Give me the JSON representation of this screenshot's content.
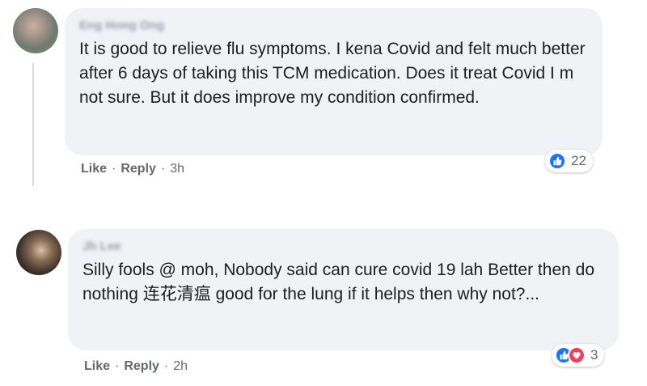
{
  "comments": [
    {
      "author": "Eng Hong Ong",
      "text": "It is good to relieve flu symptoms. I kena Covid and felt much better after 6 days of taking this TCM medication. Does it treat Covid I m not sure. But it does improve my condition confirmed.",
      "like_label": "Like",
      "reply_label": "Reply",
      "time": "3h",
      "reaction_count": "22",
      "reactions": [
        "like-icon"
      ]
    },
    {
      "author": "Jh Lee",
      "text": "Silly fools @ moh, Nobody said can cure covid 19 lah Better then do nothing 连花清瘟 good for the lung if it helps then why not?...",
      "like_label": "Like",
      "reply_label": "Reply",
      "time": "2h",
      "reaction_count": "3",
      "reactions": [
        "like-icon",
        "love-icon"
      ]
    }
  ],
  "colors": {
    "bubble": "#f0f2f5",
    "like_blue": "#1877f2",
    "love_red": "#f33e58",
    "meta_gray": "#65676b"
  }
}
